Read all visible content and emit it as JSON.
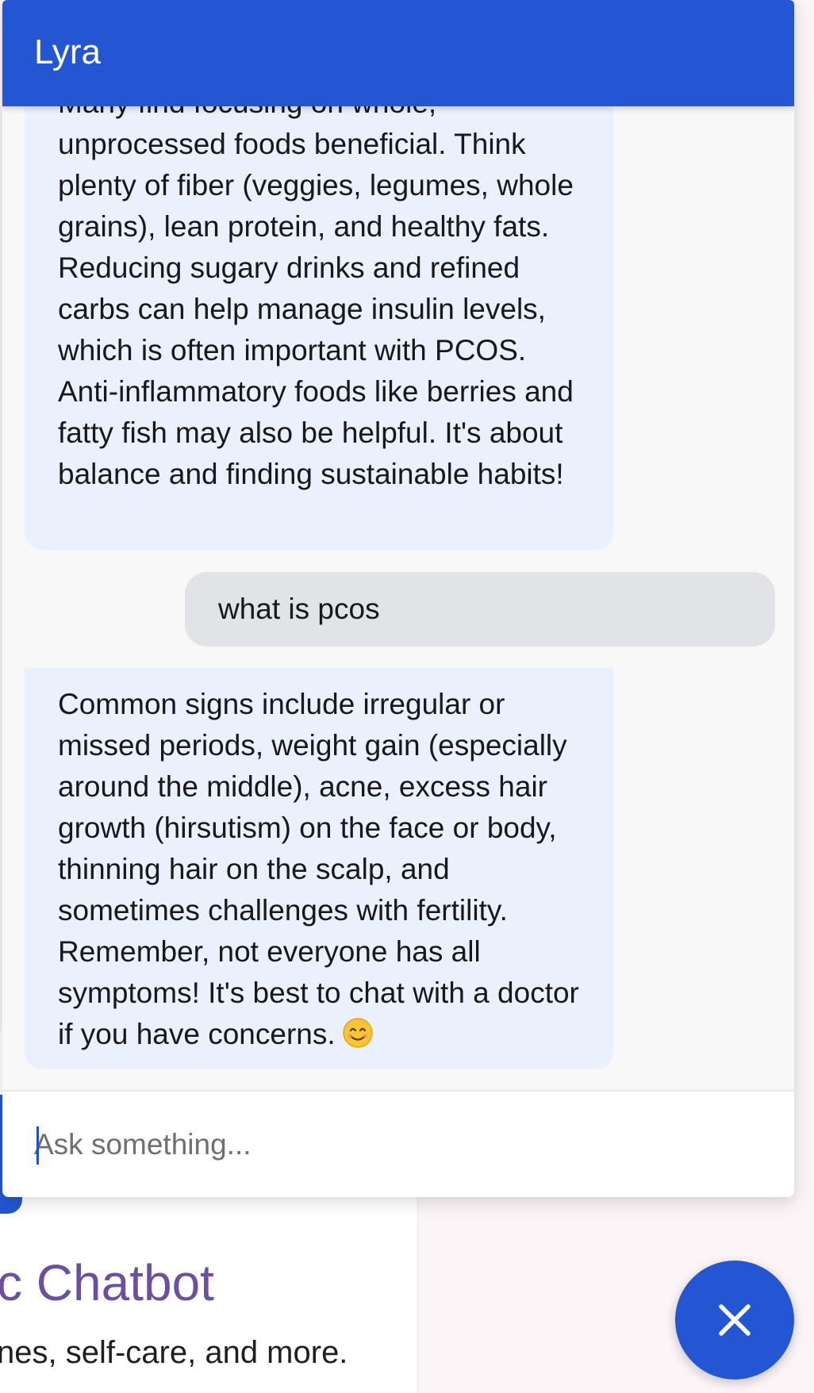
{
  "background_page": {
    "title_partial": "c Chatbot",
    "subtitle_partial": "nes, self-care, and more."
  },
  "chat": {
    "title": "Lyra",
    "messages": [
      {
        "role": "bot",
        "text": "Many find focusing on whole, unprocessed foods beneficial. Think plenty of fiber (veggies, legumes, whole grains), lean protein, and healthy fats. Reducing sugary drinks and refined carbs can help manage insulin levels, which is often important with PCOS. Anti-inflammatory foods like berries and fatty fish may also be helpful. It's about balance and finding sustainable habits!"
      },
      {
        "role": "user",
        "text": "what is pcos"
      },
      {
        "role": "bot",
        "text": "Common signs include irregular or missed periods, weight gain (especially around the middle), acne, excess hair growth (hirsutism) on the face or body, thinning hair on the scalp, and sometimes challenges with fertility. Remember, not everyone has all symptoms! It's best to chat with a doctor if you have concerns.",
        "emoji": "smiling-face-emoji"
      }
    ],
    "input": {
      "value": "",
      "placeholder": "Ask something..."
    },
    "close_icon": "close-icon"
  },
  "colors": {
    "primary": "#2456d3",
    "bot_bubble": "#eaf0fc",
    "user_bubble": "#e2e3e6",
    "background_title": "#6b4fa2"
  }
}
